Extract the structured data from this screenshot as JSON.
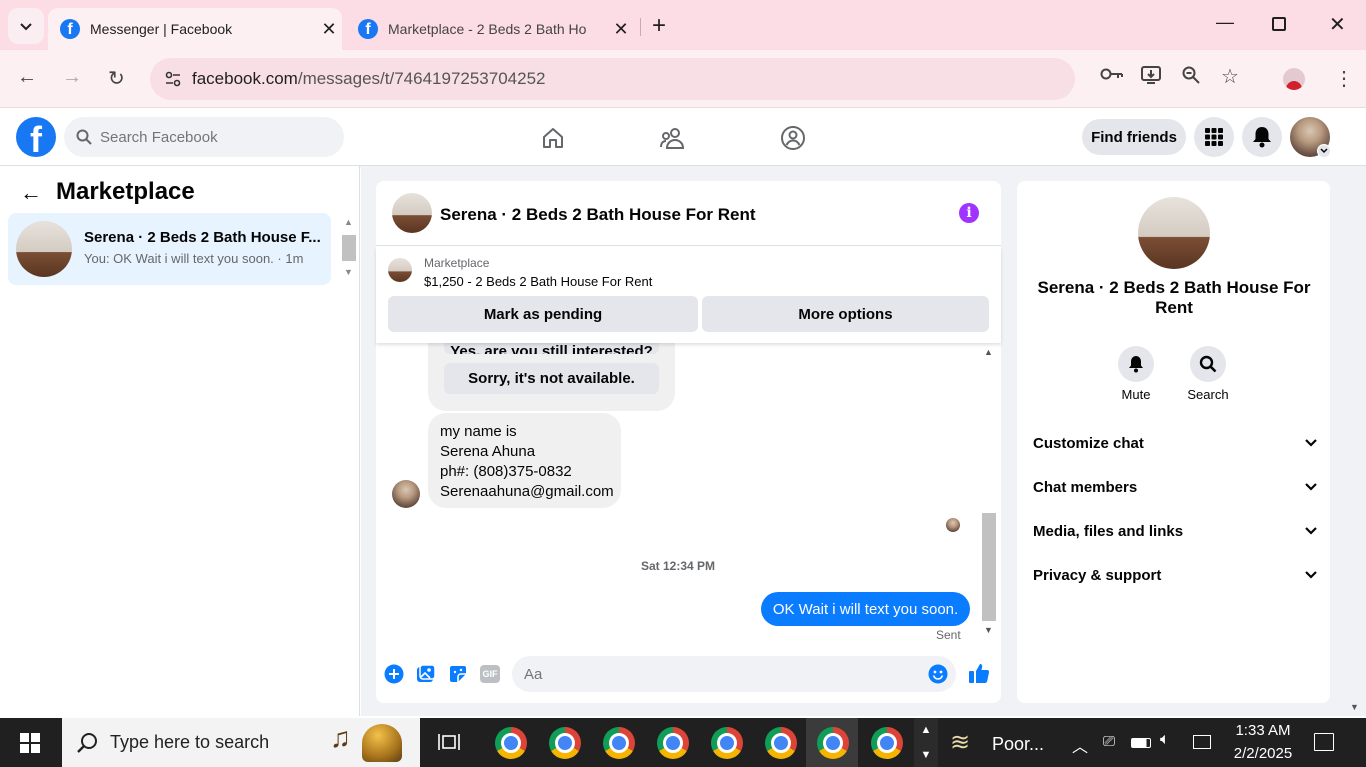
{
  "browser": {
    "tabs": [
      {
        "label": "Messenger | Facebook",
        "active": true
      },
      {
        "label": "Marketplace - 2 Beds 2 Bath Ho",
        "active": false
      }
    ],
    "url_host": "facebook.com",
    "url_path": "/messages/t/7464197253704252"
  },
  "fb_header": {
    "search_placeholder": "Search Facebook",
    "find_friends_label": "Find friends"
  },
  "sidebar": {
    "title": "Marketplace",
    "conversations": [
      {
        "name": "Serena · 2 Beds 2 Bath House F...",
        "preview": "You: OK Wait i will text you soon. · 1m"
      }
    ]
  },
  "chat": {
    "title": "Serena · 2 Beds 2 Bath House For Rent",
    "listing": {
      "source": "Marketplace",
      "summary": "$1,250 - 2 Beds 2 Bath House For Rent",
      "mark_pending_label": "Mark as pending",
      "more_options_label": "More options"
    },
    "partial_reply_option": "Yes, are you still interested?",
    "reply_option": "Sorry, it's not available.",
    "incoming_message_lines": [
      "my name is",
      "Serena Ahuna",
      "ph#: (808)375-0832",
      "Serenaahuna@gmail.com"
    ],
    "timestamp": "Sat 12:34 PM",
    "outgoing_message": "OK Wait i will text you soon.",
    "outgoing_status": "Sent",
    "composer_placeholder": "Aa",
    "gif_label": "GIF"
  },
  "details_panel": {
    "title": "Serena · 2 Beds 2 Bath House For Rent",
    "mute_label": "Mute",
    "search_label": "Search",
    "sections": [
      "Customize chat",
      "Chat members",
      "Media, files and links",
      "Privacy & support"
    ]
  },
  "taskbar": {
    "search_placeholder": "Type here to search",
    "weather": "Poor...",
    "time": "1:33 AM",
    "date": "2/2/2025"
  },
  "colors": {
    "brand": "#1877f2",
    "messenger_blue": "#0a7cff",
    "info_purple": "#a033ff",
    "chrome_tabstrip": "#fcdde6"
  }
}
